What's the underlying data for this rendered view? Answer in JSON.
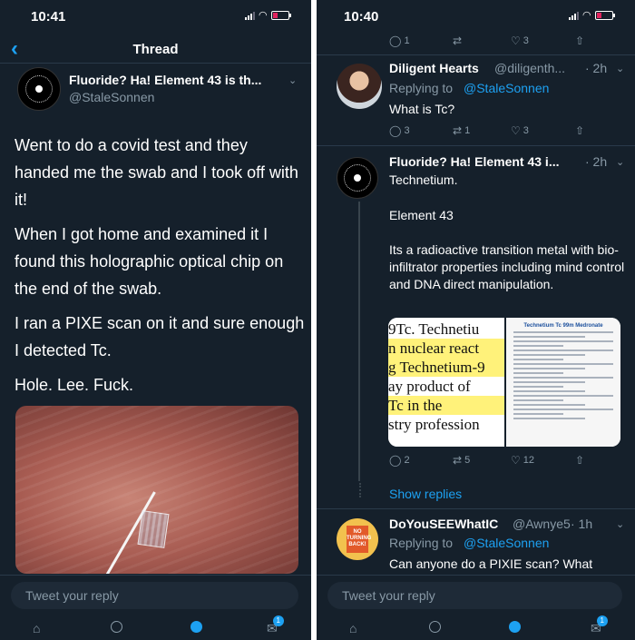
{
  "left_screen": {
    "status": {
      "time": "10:41"
    },
    "nav": {
      "title": "Thread"
    },
    "tweet": {
      "author_name": "Fluoride? Ha! Element 43 is th...",
      "author_handle": "@StaleSonnen",
      "paragraphs": [
        "Went to do a covid test and they handed me the swab and I took off with it!",
        "When I got home and examined it I found this holographic optical chip on the end of the swab.",
        "I ran a PIXE scan on it and sure enough I detected Tc.",
        "Hole. Lee. Fuck."
      ]
    },
    "reply_placeholder": "Tweet your reply",
    "tab_badge": "1"
  },
  "right_screen": {
    "status": {
      "time": "10:40"
    },
    "top_actions": {
      "replies": "1",
      "retweets": "",
      "likes": "3"
    },
    "reply1": {
      "name": "Diligent Hearts",
      "handle": "@diligenth...",
      "time": "· 2h",
      "replying_prefix": "Replying to",
      "replying_to": "@StaleSonnen",
      "text": "What is Tc?",
      "actions": {
        "replies": "3",
        "retweets": "1",
        "likes": "3"
      }
    },
    "reply2": {
      "name": "Fluoride? Ha! Element 43 i...",
      "time": "· 2h",
      "lines": [
        "Technetium.",
        "Element 43",
        "Its a radioactive transition metal with bio-infiltrator properties including mind control and DNA direct manipulation."
      ],
      "media_left_lines": [
        "9Tc. Technetiu",
        "n nuclear react",
        "g Technetium-9",
        "ay product of",
        "Tc in the",
        "stry profession"
      ],
      "media_right_title": "Technetium Tc 99m Medronate",
      "actions": {
        "replies": "2",
        "retweets": "5",
        "likes": "12"
      }
    },
    "show_replies": "Show replies",
    "reply3": {
      "name": "DoYouSEEWhatIC",
      "handle": "@Awnye5",
      "time": "· 1h",
      "replying_prefix": "Replying to",
      "replying_to": "@StaleSonnen",
      "text": "Can anyone do a PIXIE scan? What",
      "avatar_sign": "NO TURNING BACK!"
    },
    "reply_placeholder": "Tweet your reply",
    "tab_badge": "1"
  }
}
